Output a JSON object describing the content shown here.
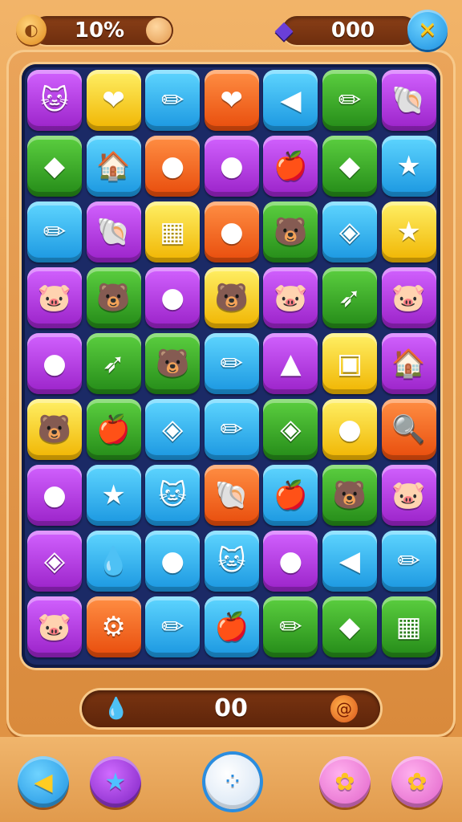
{
  "hud": {
    "progress_text": "10%",
    "progress_fraction": 0.1,
    "gem_count": "000",
    "close_icon": "close-x-icon",
    "shell_icon": "acorn-icon",
    "gem_icon": "purple-gem-icon"
  },
  "board": {
    "rows": 9,
    "cols": 7,
    "tiles": [
      [
        [
          "purple",
          "cat-face-icon",
          "🐱"
        ],
        [
          "yellow",
          "heart-icon",
          "❤"
        ],
        [
          "blue",
          "pencil-icon",
          "✏"
        ],
        [
          "orange",
          "heart-icon",
          "❤"
        ],
        [
          "blue",
          "triangle-flag-icon",
          "◀"
        ],
        [
          "green",
          "pencil-icon",
          "✏"
        ],
        [
          "purple",
          "shell-icon",
          "🐚"
        ]
      ],
      [
        [
          "green",
          "leaf-icon",
          "◆"
        ],
        [
          "blue",
          "house-icon",
          "🏠"
        ],
        [
          "orange",
          "balloon-icon",
          "●"
        ],
        [
          "purple",
          "balloon-icon",
          "●"
        ],
        [
          "purple",
          "apple-icon",
          "🍎"
        ],
        [
          "green",
          "leaf-icon",
          "◆"
        ],
        [
          "blue",
          "star-icon",
          "★"
        ]
      ],
      [
        [
          "blue",
          "pencil-icon",
          "✏"
        ],
        [
          "purple",
          "shell-icon",
          "🐚"
        ],
        [
          "yellow",
          "calendar-icon",
          "▦"
        ],
        [
          "orange",
          "speech-bubble-icon",
          "●"
        ],
        [
          "green",
          "bear-face-icon",
          "🐻"
        ],
        [
          "blue",
          "cube-icon",
          "◈"
        ],
        [
          "yellow",
          "gem-star-icon",
          "★"
        ]
      ],
      [
        [
          "purple",
          "pig-face-icon",
          "🐷"
        ],
        [
          "green",
          "bear-face-icon",
          "🐻"
        ],
        [
          "purple",
          "lollipop-icon",
          "●"
        ],
        [
          "yellow",
          "bear-face-icon",
          "🐻"
        ],
        [
          "purple",
          "pig-face-icon",
          "🐷"
        ],
        [
          "green",
          "arrow-icon",
          "➶"
        ],
        [
          "purple",
          "pig-face-icon",
          "🐷"
        ]
      ],
      [
        [
          "purple",
          "balloon-icon",
          "●"
        ],
        [
          "green",
          "arrow-icon",
          "➶"
        ],
        [
          "green",
          "bear-face-icon",
          "🐻"
        ],
        [
          "blue",
          "pencil-icon",
          "✏"
        ],
        [
          "purple",
          "bell-icon",
          "▲"
        ],
        [
          "yellow",
          "box-icon",
          "▣"
        ],
        [
          "purple",
          "house-icon",
          "🏠"
        ]
      ],
      [
        [
          "yellow",
          "bear-face-icon",
          "🐻"
        ],
        [
          "green",
          "apple-icon",
          "🍎"
        ],
        [
          "blue",
          "crystal-icon",
          "◈"
        ],
        [
          "blue",
          "pencil-icon",
          "✏"
        ],
        [
          "green",
          "crystal-icon",
          "◈"
        ],
        [
          "yellow",
          "bubble-icon",
          "●"
        ],
        [
          "orange",
          "magnifier-icon",
          "🔍"
        ]
      ],
      [
        [
          "purple",
          "balloon-icon",
          "●"
        ],
        [
          "blue",
          "star-icon",
          "★"
        ],
        [
          "blue",
          "cat-face-icon",
          "🐱"
        ],
        [
          "orange",
          "shell-icon",
          "🐚"
        ],
        [
          "blue",
          "apple-icon",
          "🍎"
        ],
        [
          "green",
          "bear-face-icon",
          "🐻"
        ],
        [
          "purple",
          "pig-face-icon",
          "🐷"
        ]
      ],
      [
        [
          "purple",
          "crystal-icon",
          "◈"
        ],
        [
          "blue",
          "drop-icon",
          "💧"
        ],
        [
          "blue",
          "speech-bubble-icon",
          "●"
        ],
        [
          "blue",
          "cat-face-icon",
          "🐱"
        ],
        [
          "purple",
          "balloon-icon",
          "●"
        ],
        [
          "blue",
          "triangle-flag-icon",
          "◀"
        ],
        [
          "blue",
          "pencil-icon",
          "✏"
        ]
      ],
      [
        [
          "purple",
          "pig-face-icon",
          "🐷"
        ],
        [
          "orange",
          "gear-icon",
          "⚙"
        ],
        [
          "blue",
          "pencil-icon",
          "✏"
        ],
        [
          "blue",
          "apple-icon",
          "🍎"
        ],
        [
          "green",
          "pencil-icon",
          "✏"
        ],
        [
          "green",
          "leaf-icon",
          "◆"
        ],
        [
          "green",
          "note-icon",
          "▦"
        ]
      ]
    ]
  },
  "moves_bar": {
    "count": "00",
    "left_icon": "water-drop-icon",
    "right_icon": "spiral-icon"
  },
  "buttons": [
    {
      "name": "triangle-flag-button",
      "icon": "◀",
      "color": "blue"
    },
    {
      "name": "star-button",
      "icon": "★",
      "color": "purple"
    },
    {
      "name": "menu-button",
      "icon": "⁘",
      "color": "white"
    },
    {
      "name": "flower-button-1",
      "icon": "✿",
      "color": "pink"
    },
    {
      "name": "flower-button-2",
      "icon": "✿",
      "color": "pink"
    }
  ],
  "colors": {
    "purple": "#b438e0",
    "yellow": "#ffd51e",
    "blue": "#26b6f2",
    "orange": "#ff6a1f",
    "green": "#3fae2a",
    "pink": "#f080d8",
    "white": "#e9f3ff"
  }
}
